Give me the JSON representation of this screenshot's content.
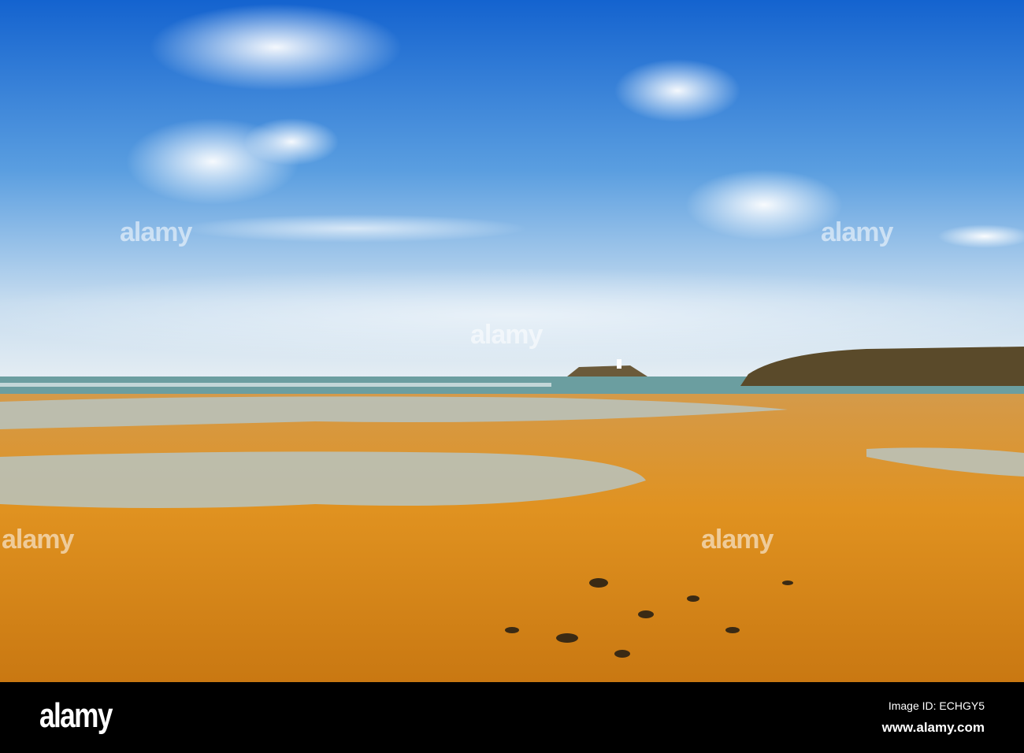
{
  "photo": {
    "subject": "beach"
  },
  "watermark": {
    "text": "alamy"
  },
  "footer": {
    "logo": "alamy",
    "image_id": "Image ID: ECHGY5",
    "url": "www.alamy.com"
  },
  "colors": {
    "sky_top": "#1a6fd6",
    "sky_low": "#cfe2f2",
    "sand": "#d98a1c",
    "sand_dark": "#9a5a10",
    "sea": "#6fa3a8"
  }
}
